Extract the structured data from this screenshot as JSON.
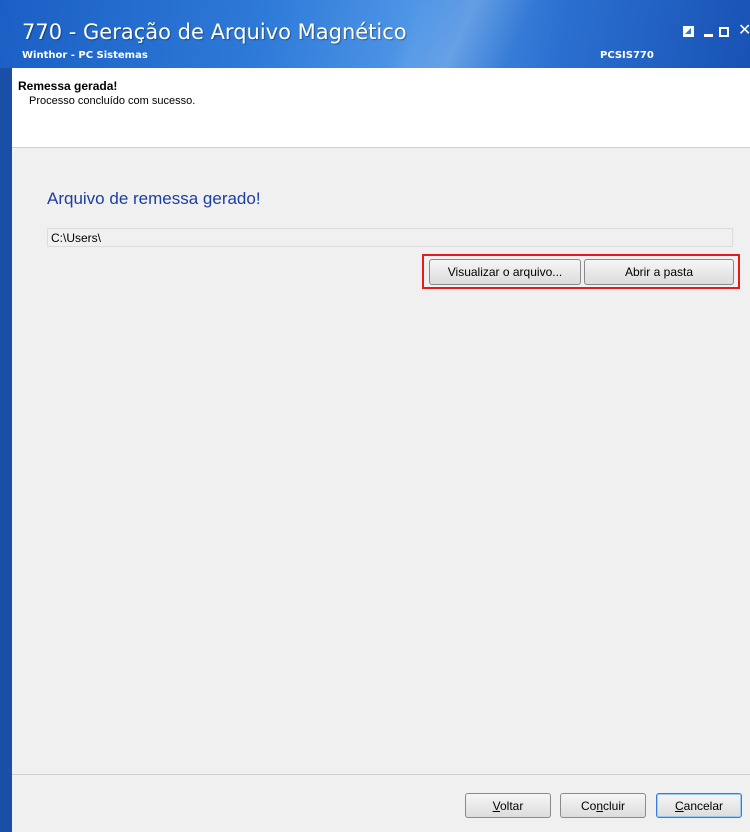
{
  "window": {
    "title": "770 - Geração de Arquivo Magnético",
    "subtitle": "Winthor - PC Sistemas",
    "code": "PCSIS770",
    "close_glyph": "✕"
  },
  "header": {
    "title": "Remessa gerada!",
    "message": "Processo concluído com sucesso."
  },
  "main": {
    "heading": "Arquivo de remessa gerado!",
    "path_value": "C:\\Users\\",
    "view_button": "Visualizar o arquivo...",
    "open_folder_button": "Abrir a pasta"
  },
  "footer": {
    "back_first": "V",
    "back_rest": "oltar",
    "finish_first": "Co",
    "finish_u": "n",
    "finish_rest": "cluir",
    "cancel_first": "C",
    "cancel_rest": "ancelar"
  },
  "colors": {
    "title_bar": "#2e7ad8",
    "heading": "#1b3fa0",
    "highlight": "#e31b1b"
  }
}
